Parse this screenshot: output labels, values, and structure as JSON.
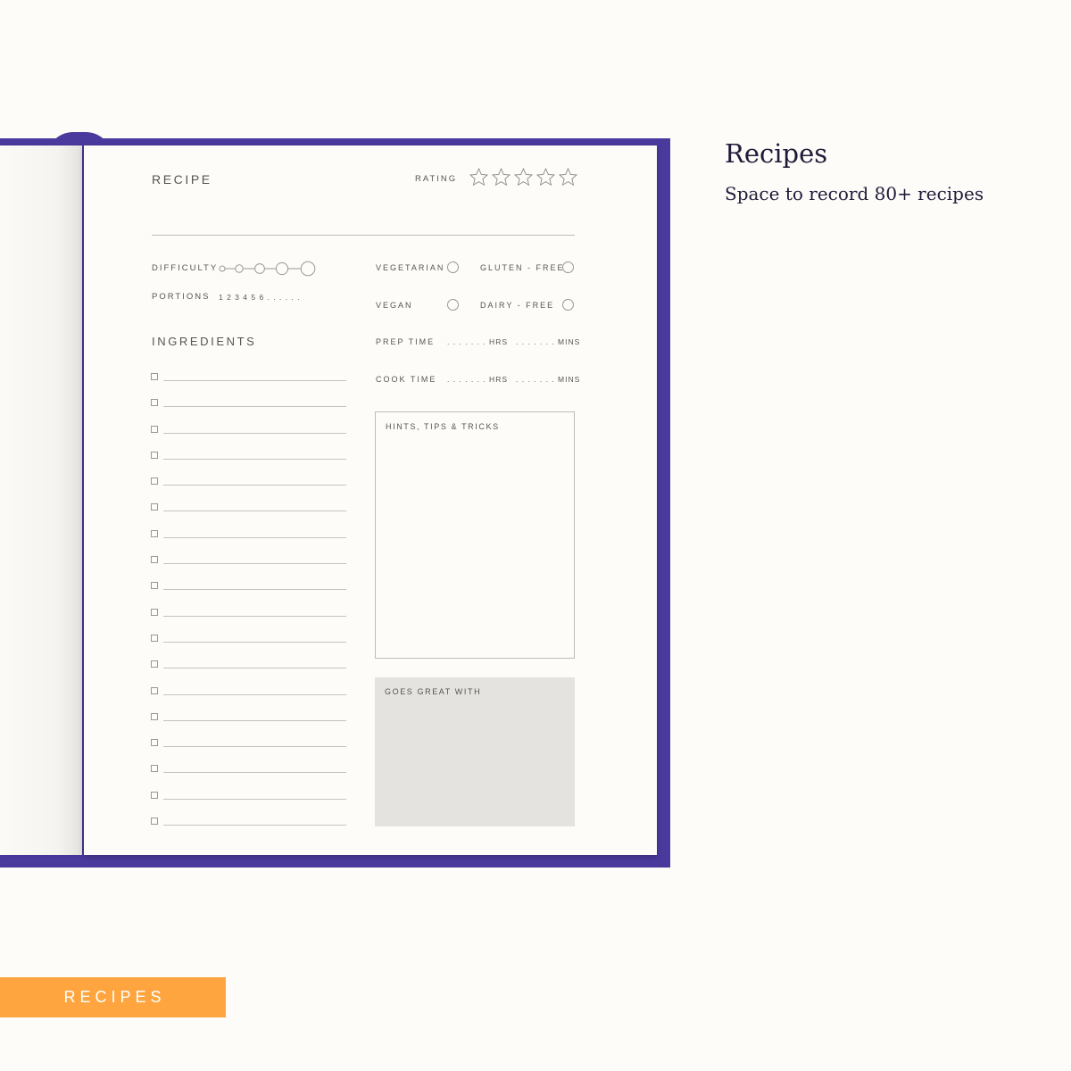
{
  "heading": {
    "title": "Recipes",
    "subtitle": "Space to record 80+ recipes"
  },
  "section_tag": "RECIPES",
  "colors": {
    "cover": "#4a3a9e",
    "tag": "#ffa53f",
    "heading": "#231a3a",
    "shaded_box": "#e4e3df"
  },
  "recipe_page": {
    "recipe_label": "RECIPE",
    "rating_label": "RATING",
    "rating_stars": 5,
    "difficulty_label": "DIFFICULTY",
    "portions_label": "PORTIONS",
    "portions_options": "1  2  3  4  5  6  . . . . . .",
    "ingredients_label": "INGREDIENTS",
    "ingredient_rows": 18,
    "dietary": {
      "vegetarian": "VEGETARIAN",
      "gluten_free": "GLUTEN - FREE",
      "vegan": "VEGAN",
      "dairy_free": "DAIRY - FREE"
    },
    "prep_time_label": "PREP TIME",
    "cook_time_label": "COOK TIME",
    "hrs_blank": ". . . . . . . HRS",
    "mins_blank": ". . . . . . . MINS",
    "hints_label": "HINTS, TIPS & TRICKS",
    "goes_label": "GOES GREAT WITH"
  }
}
